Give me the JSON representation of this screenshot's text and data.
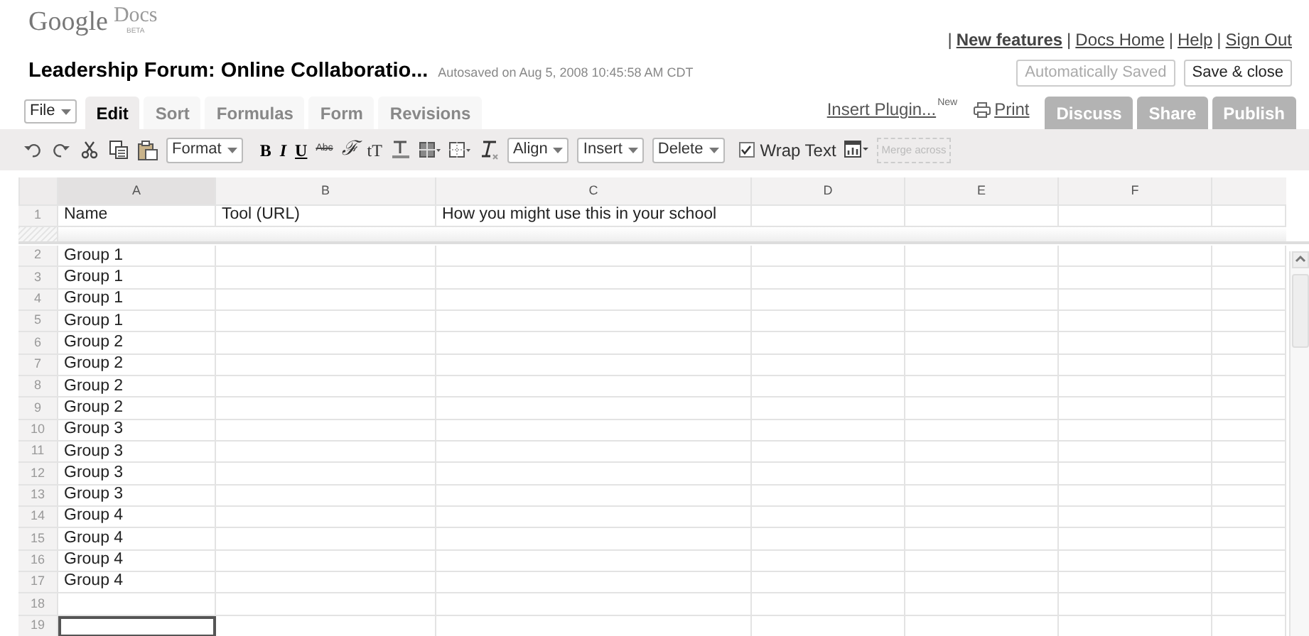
{
  "logo": {
    "name": "Google",
    "product": "Docs",
    "badge": "BETA"
  },
  "top_links": {
    "separator": "|",
    "items": [
      {
        "label": "New features",
        "emphasized": true
      },
      {
        "label": "Docs Home",
        "emphasized": false
      },
      {
        "label": "Help",
        "emphasized": false
      },
      {
        "label": "Sign Out",
        "emphasized": false
      }
    ]
  },
  "document": {
    "title": "Leadership Forum: Online Collaboratio...",
    "autosave": "Autosaved on Aug 5, 2008 10:45:58 AM CDT"
  },
  "header_buttons": [
    {
      "label": "Automatically Saved",
      "disabled": true
    },
    {
      "label": "Save & close",
      "disabled": false
    }
  ],
  "file_menu": "File",
  "tabs": [
    {
      "label": "Edit",
      "selected": true
    },
    {
      "label": "Sort",
      "selected": false
    },
    {
      "label": "Formulas",
      "selected": false
    },
    {
      "label": "Form",
      "selected": false
    },
    {
      "label": "Revisions",
      "selected": false
    }
  ],
  "insert_plugin": {
    "label": "Insert Plugin...",
    "badge": "New"
  },
  "print": "Print",
  "share_tabs": [
    {
      "label": "Discuss",
      "selected": false
    },
    {
      "label": "Share",
      "selected": false
    },
    {
      "label": "Publish",
      "selected": false
    }
  ],
  "toolbar": {
    "format_menu": "Format",
    "style_buttons": [
      "B",
      "I",
      "U",
      "Abc",
      "ℱ",
      "tT"
    ],
    "align_menu": "Align",
    "insert_menu": "Insert",
    "delete_menu": "Delete",
    "wrap_text": {
      "label": "Wrap Text",
      "checked": true
    },
    "merge_button": {
      "label": "Merge across",
      "disabled": true
    }
  },
  "sheet": {
    "columns": [
      "A",
      "B",
      "C",
      "D",
      "E",
      "F"
    ],
    "frozen_rows": [
      {
        "number": "1",
        "cells": [
          "Name",
          "Tool (URL)",
          "How you might use this in your school"
        ],
        "selected": false
      }
    ],
    "rows": [
      {
        "number": "2",
        "cells": [
          "Group 1"
        ],
        "selected": false
      },
      {
        "number": "3",
        "cells": [
          "Group 1"
        ],
        "selected": false
      },
      {
        "number": "4",
        "cells": [
          "Group 1"
        ],
        "selected": false
      },
      {
        "number": "5",
        "cells": [
          "Group 1"
        ],
        "selected": false
      },
      {
        "number": "6",
        "cells": [
          "Group 2"
        ],
        "selected": false
      },
      {
        "number": "7",
        "cells": [
          "Group 2"
        ],
        "selected": false
      },
      {
        "number": "8",
        "cells": [
          "Group 2"
        ],
        "selected": false
      },
      {
        "number": "9",
        "cells": [
          "Group 2"
        ],
        "selected": false
      },
      {
        "number": "10",
        "cells": [
          "Group 3"
        ],
        "selected": false
      },
      {
        "number": "11",
        "cells": [
          "Group 3"
        ],
        "selected": false
      },
      {
        "number": "12",
        "cells": [
          "Group 3"
        ],
        "selected": false
      },
      {
        "number": "13",
        "cells": [
          "Group 3"
        ],
        "selected": false
      },
      {
        "number": "14",
        "cells": [
          "Group 4"
        ],
        "selected": false
      },
      {
        "number": "15",
        "cells": [
          "Group 4"
        ],
        "selected": false
      },
      {
        "number": "16",
        "cells": [
          "Group 4"
        ],
        "selected": false
      },
      {
        "number": "17",
        "cells": [
          "Group 4"
        ],
        "selected": false
      },
      {
        "number": "18",
        "selected": false
      },
      {
        "number": "19",
        "selected": true
      }
    ]
  }
}
